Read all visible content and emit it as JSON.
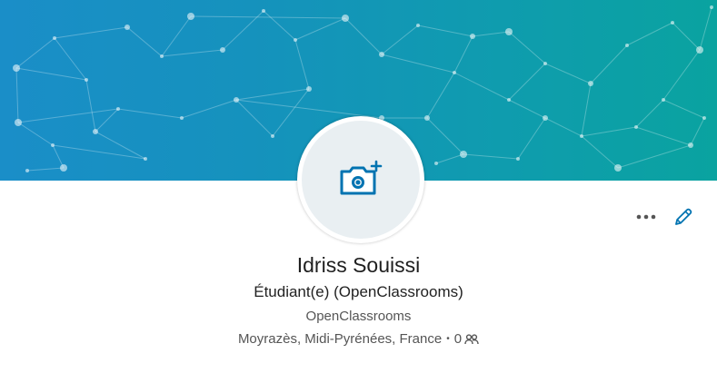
{
  "profile": {
    "name": "Idriss Souissi",
    "headline": "Étudiant(e) (OpenClassrooms)",
    "company": "OpenClassrooms",
    "location": "Moyrazès, Midi-Pyrénées, France",
    "separator": "•",
    "connections_count": "0"
  },
  "icons": {
    "avatar": "camera-plus-icon",
    "more": "more-dots-icon",
    "edit": "pencil-icon",
    "connections": "people-icon"
  },
  "colors": {
    "accent": "#0073b1",
    "banner_left": "#1a8ec8",
    "banner_right": "#0aa3a0"
  }
}
